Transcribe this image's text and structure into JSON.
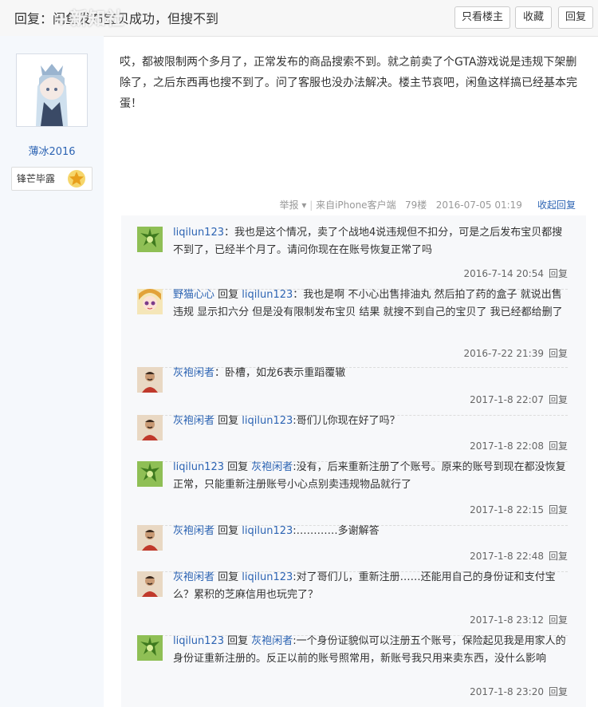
{
  "header": {
    "title": "回复：闲鱼发布宝贝成功，但搜不到",
    "watermark": "+新知社",
    "buttons": {
      "only_op": "只看楼主",
      "collect": "收藏",
      "reply": "回复"
    }
  },
  "author": {
    "name": "薄冰2016",
    "badge": "锋芒毕露",
    "badge_icon": "star-badge-icon"
  },
  "post": {
    "body": "哎，都被限制两个多月了，正常发布的商品搜索不到。就之前卖了个GTA游戏说是违规下架删除了，之后东西再也搜不到了。问了客服也没办法解决。楼主节哀吧，闲鱼这样搞已经基本完蛋！",
    "meta": {
      "report": "举报",
      "source": "来自iPhone客户端",
      "floor": "79楼",
      "time": "2016-07-05 01:19",
      "collapse": "收起回复"
    }
  },
  "replies": [
    {
      "user": "liqilun123",
      "target": "",
      "text": "我也是这个情况，卖了个战地4说违规但不扣分，可是之后发布宝贝都搜不到了，已经半个月了。请问你现在在账号恢复正常了吗",
      "time": "2016-7-14 20:54",
      "reply": "回复",
      "avatar": "green"
    },
    {
      "user": "野猫心心",
      "target": "liqilun123",
      "text": "：我也是啊 不小心出售排油丸 然后拍了药的盒子 就说出售违规 显示扣六分 但是没有限制发布宝贝 结果 就搜不到自己的宝贝了 我已经都给删了",
      "time": "2016-7-22 21:39",
      "reply": "回复",
      "avatar": "anime"
    },
    {
      "user": "灰袍闲者",
      "target": "",
      "text": "卧槽，如龙6表示重蹈覆辙",
      "time": "2017-1-8 22:07",
      "reply": "回复",
      "avatar": "man"
    },
    {
      "user": "灰袍闲者",
      "target": "liqilun123",
      "text": ":哥们儿你现在好了吗？",
      "time": "2017-1-8 22:08",
      "reply": "回复",
      "avatar": "man"
    },
    {
      "user": "liqilun123",
      "target": "灰袍闲者",
      "text": ":没有，后来重新注册了个账号。原来的账号到现在都没恢复正常，只能重新注册账号小心点别卖违规物品就行了",
      "time": "2017-1-8 22:15",
      "reply": "回复",
      "avatar": "green"
    },
    {
      "user": "灰袍闲者",
      "target": "liqilun123",
      "text": ":…………多谢解答",
      "time": "2017-1-8 22:48",
      "reply": "回复",
      "avatar": "man"
    },
    {
      "user": "灰袍闲者",
      "target": "liqilun123",
      "text": ":对了哥们儿，重新注册……还能用自己的身份证和支付宝么？累积的芝麻信用也玩完了？",
      "time": "2017-1-8 23:12",
      "reply": "回复",
      "avatar": "man"
    },
    {
      "user": "liqilun123",
      "target": "灰袍闲者",
      "text": ":一个身份证貌似可以注册五个账号，保险起见我是用家人的身份证重新注册的。反正以前的账号照常用，新账号我只用来卖东西，没什么影响",
      "time": "2017-1-8 23:20",
      "reply": "回复",
      "avatar": "green"
    }
  ],
  "labels": {
    "reply_word": "回复 "
  }
}
